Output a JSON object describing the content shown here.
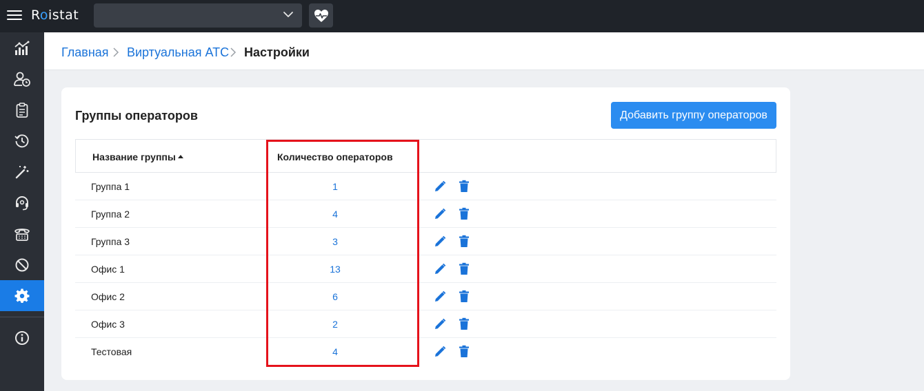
{
  "header": {
    "logo_text_pre": "R",
    "logo_text_dot": "o",
    "logo_text_post": "istat",
    "project_select_value": ""
  },
  "sidebar": {
    "items": [
      {
        "icon": "analytics-chart-icon"
      },
      {
        "icon": "user-clock-icon"
      },
      {
        "icon": "clipboard-icon"
      },
      {
        "icon": "history-icon"
      },
      {
        "icon": "magic-wand-icon"
      },
      {
        "icon": "headset-icon"
      },
      {
        "icon": "telephone-icon"
      },
      {
        "icon": "block-icon"
      },
      {
        "icon": "gear-icon",
        "active": true
      },
      {
        "icon": "info-icon"
      }
    ],
    "accent_color": "#1a7ce6"
  },
  "breadcrumb": {
    "items": [
      "Главная",
      "Виртуальная АТС",
      "Настройки"
    ]
  },
  "card": {
    "title": "Группы операторов",
    "add_button_label": "Добавить группу операторов"
  },
  "table": {
    "columns": [
      "Название группы",
      "Количество операторов"
    ],
    "sort_column": "Название группы",
    "sort_direction": "asc",
    "rows": [
      {
        "name": "Группа 1",
        "count": "1"
      },
      {
        "name": "Группа 2",
        "count": "4"
      },
      {
        "name": "Группа 3",
        "count": "3"
      },
      {
        "name": "Офис 1",
        "count": "13"
      },
      {
        "name": "Офис 2",
        "count": "6"
      },
      {
        "name": "Офис 3",
        "count": "2"
      },
      {
        "name": "Тестовая",
        "count": "4"
      }
    ]
  },
  "colors": {
    "link": "#1a73d9",
    "button": "#2b8cf0",
    "highlight_border": "#e5121b"
  }
}
